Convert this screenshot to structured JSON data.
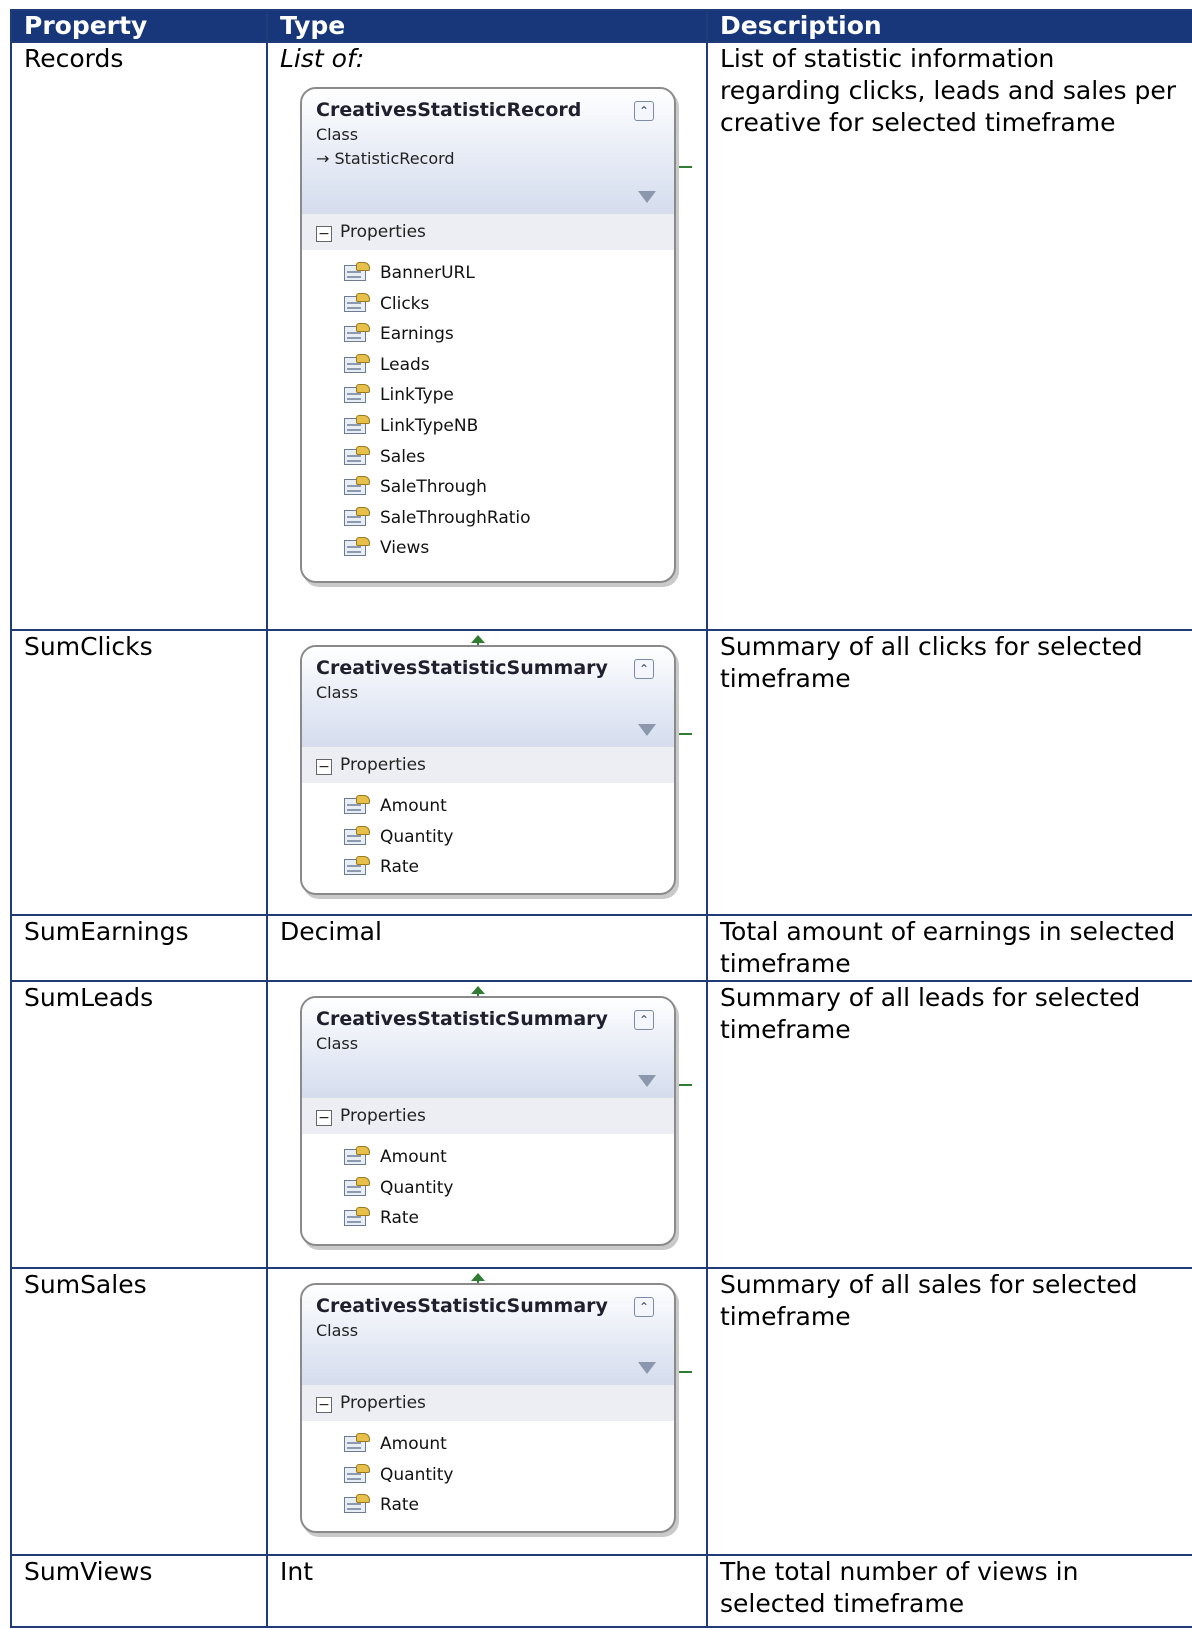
{
  "table": {
    "headers": [
      "Property",
      "Type",
      "Description"
    ],
    "rows": [
      {
        "property": "Records",
        "type_text": "List of:",
        "description": "List of statistic information regarding clicks, leads and sales per creative for selected timeframe",
        "diagram": {
          "title": "CreativesStatisticRecord",
          "kind": "Class",
          "inherits": "→ StatisticRecord",
          "section": "Properties",
          "properties": [
            "BannerURL",
            "Clicks",
            "Earnings",
            "Leads",
            "LinkType",
            "LinkTypeNB",
            "Sales",
            "SaleThrough",
            "SaleThroughRatio",
            "Views"
          ]
        }
      },
      {
        "property": "SumClicks",
        "description": "Summary of all clicks for selected timeframe",
        "diagram": {
          "title": "CreativesStatisticSummary",
          "kind": "Class",
          "section": "Properties",
          "properties": [
            "Amount",
            "Quantity",
            "Rate"
          ]
        }
      },
      {
        "property": "SumEarnings",
        "type_text": "Decimal",
        "description": "Total amount of earnings in selected timeframe"
      },
      {
        "property": "SumLeads",
        "description": "Summary of all leads for selected timeframe",
        "diagram": {
          "title": "CreativesStatisticSummary",
          "kind": "Class",
          "section": "Properties",
          "properties": [
            "Amount",
            "Quantity",
            "Rate"
          ]
        }
      },
      {
        "property": "SumSales",
        "description": "Summary of all sales for selected timeframe",
        "diagram": {
          "title": "CreativesStatisticSummary",
          "kind": "Class",
          "section": "Properties",
          "properties": [
            "Amount",
            "Quantity",
            "Rate"
          ]
        }
      },
      {
        "property": "SumViews",
        "type_text": "Int",
        "description": "The total number of views in selected timeframe"
      }
    ]
  },
  "colors": {
    "header_bg": "#17377a",
    "border": "#1f3b78",
    "connector": "#2e7d32"
  },
  "icons": {
    "collapse": "double-chevron-up-icon",
    "filter": "filter-icon",
    "property": "property-icon",
    "section": "minus-box-icon"
  }
}
